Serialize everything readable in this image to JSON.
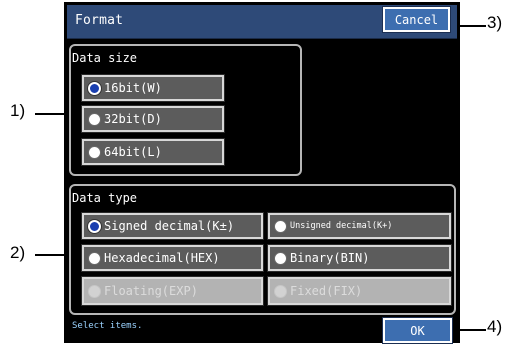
{
  "window": {
    "title": "Format"
  },
  "buttons": {
    "cancel": "Cancel",
    "ok": "OK"
  },
  "data_size": {
    "label": "Data size",
    "options": [
      {
        "label": "16bit(W)",
        "selected": true
      },
      {
        "label": "32bit(D)",
        "selected": false
      },
      {
        "label": "64bit(L)",
        "selected": false
      }
    ]
  },
  "data_type": {
    "label": "Data type",
    "options": [
      {
        "label": "Signed decimal(K±)",
        "selected": true,
        "enabled": true
      },
      {
        "label": "Unsigned decimal(K+)",
        "selected": false,
        "enabled": true
      },
      {
        "label": "Hexadecimal(HEX)",
        "selected": false,
        "enabled": true
      },
      {
        "label": "Binary(BIN)",
        "selected": false,
        "enabled": true
      },
      {
        "label": "Floating(EXP)",
        "selected": false,
        "enabled": false
      },
      {
        "label": "Fixed(FIX)",
        "selected": false,
        "enabled": false
      }
    ]
  },
  "status": "Select items.",
  "annotations": {
    "a1": "1)",
    "a2": "2)",
    "a3": "3)",
    "a4": "4)"
  },
  "colors": {
    "titlebar": "#2e4a78",
    "button": "#3d6eb0",
    "option": "#5c5c5c",
    "disabled": "#b3b3b3",
    "selected_radio": "#1a3fb0"
  }
}
